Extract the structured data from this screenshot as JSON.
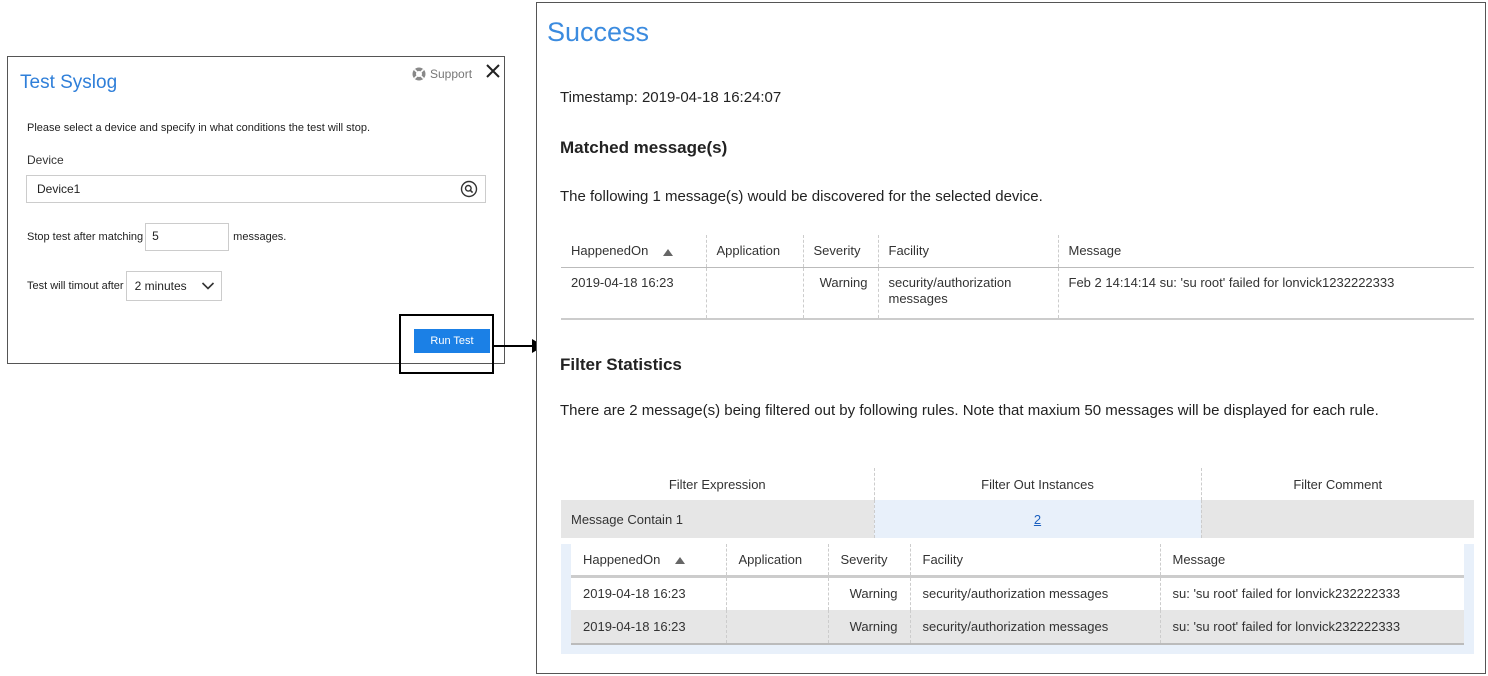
{
  "dialog": {
    "title": "Test Syslog",
    "support_label": "Support",
    "instructions": "Please select a device and specify in what conditions the test will stop.",
    "device_label": "Device",
    "device_value": "Device1",
    "stop_prefix": "Stop test after matching",
    "stop_value": "5",
    "stop_suffix": "messages.",
    "timeout_label": "Test will timout after",
    "timeout_value": "2 minutes",
    "run_label": "Run Test"
  },
  "result": {
    "title": "Success",
    "timestamp": "Timestamp: 2019-04-18 16:24:07",
    "matched_heading": "Matched message(s)",
    "matched_desc": "The following 1 message(s) would be discovered for the selected device.",
    "matched_table": {
      "headers": [
        "HappenedOn",
        "Application",
        "Severity",
        "Facility",
        "Message"
      ],
      "rows": [
        {
          "happened": "2019-04-18 16:23",
          "application": "",
          "severity": "Warning",
          "facility": "security/authorization messages",
          "message": "Feb 2 14:14:14                 su: 'su root' failed for lonvick1232222333"
        }
      ]
    },
    "filter_heading": "Filter Statistics",
    "filter_desc": "There are 2 message(s) being filtered out by following rules. Note that maxium 50 messages will be displayed for each rule.",
    "filter_table": {
      "headers": [
        "Filter Expression",
        "Filter Out Instances",
        "Filter Comment"
      ],
      "row": {
        "expression": "Message Contain 1",
        "instances": "2",
        "comment": ""
      }
    },
    "sub_table": {
      "headers": [
        "HappenedOn",
        "Application",
        "Severity",
        "Facility",
        "Message"
      ],
      "rows": [
        {
          "happened": "2019-04-18 16:23",
          "application": "",
          "severity": "Warning",
          "facility": "security/authorization messages",
          "message": "su: 'su root' failed for lonvick232222333"
        },
        {
          "happened": "2019-04-18 16:23",
          "application": "",
          "severity": "Warning",
          "facility": "security/authorization messages",
          "message": "su: 'su root' failed for lonvick232222333"
        }
      ]
    }
  },
  "colors": {
    "accent": "#1b80e6",
    "title_blue": "#3b8bdf",
    "link": "#1b60c0"
  },
  "icons": [
    "lifebuoy-icon",
    "close-icon",
    "search-icon",
    "chevron-down-icon",
    "sort-up-icon",
    "arrow-right-icon"
  ]
}
